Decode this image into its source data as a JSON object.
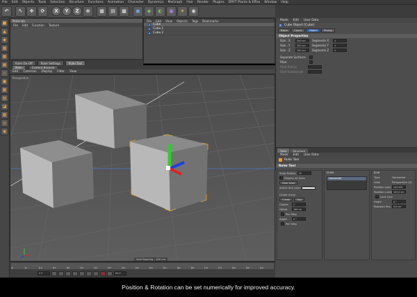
{
  "menu": [
    "File",
    "Edit",
    "Objects",
    "Tools",
    "Selection",
    "Structure",
    "Functions",
    "Animation",
    "Character",
    "Dynamics",
    "MoGraph",
    "Hair",
    "Render",
    "Plugins",
    "DRYT Plants & Effex",
    "Window",
    "Help"
  ],
  "toolbar": {
    "undo": "↶",
    "live": "↖",
    "move": "✥",
    "rotate": "⟳",
    "x_axis": "X",
    "y_axis": "Y",
    "z_axis": "Z",
    "coord": "⊕",
    "render1": "▦",
    "render2": "▤",
    "render3": "▩",
    "cube": "◼",
    "extra1": "◆",
    "extra2": "◐",
    "extra3": "▣",
    "extra4": "✶",
    "extra5": "◉"
  },
  "left_icons": [
    "■",
    "▲",
    "◆",
    "▦",
    "▦",
    "▦",
    "◇",
    "◼",
    "▦",
    "▤",
    "◪",
    "▩",
    "◎",
    "◉"
  ],
  "script_window": {
    "title": "Materials",
    "menu": [
      "File",
      "Edit",
      "Function",
      "Texture"
    ]
  },
  "object_manager": {
    "menu": [
      "File",
      "Edit",
      "View",
      "Objects",
      "Tags",
      "Bookmarks"
    ],
    "objects": [
      "Cube",
      "Cube.1",
      "Cube.2"
    ]
  },
  "viewport_tabs": [
    "Ruler On-Off",
    "Ruler Settings",
    "Ruler Tool"
  ],
  "viewport_head": [
    "Main",
    "Content Browser"
  ],
  "viewport_menu": [
    "Edit",
    "Cameras",
    "Display",
    "Filter",
    "View"
  ],
  "viewport_label": "Perspective",
  "grid_status": "Grid Spacing : 100 cm",
  "timeline": {
    "ticks": [
      "0",
      "5",
      "10",
      "15",
      "20",
      "25",
      "30",
      "35",
      "40",
      "45",
      "50",
      "55",
      "60",
      "65",
      "70",
      "75",
      "80",
      "85",
      "90"
    ],
    "start": "0 F",
    "end": "90 F"
  },
  "attributes": {
    "menu": [
      "Mode",
      "Edit",
      "User Data"
    ],
    "object": "Cube Object [Cube]",
    "tabs": [
      "Basic",
      "Coord.",
      "Object",
      "Phong"
    ],
    "section": "Object Properties",
    "rows": [
      {
        "label": "Size . X",
        "value": "200 cm",
        "seg_label": "Segments X",
        "seg": "1"
      },
      {
        "label": "Size . Y",
        "value": "200 cm",
        "seg_label": "Segments Y",
        "seg": "1"
      },
      {
        "label": "Size . Z",
        "value": "200 cm",
        "seg_label": "Segments Z",
        "seg": "1"
      }
    ],
    "separate": "Separate Surfaces",
    "fillet": "Fillet",
    "fillet_radius": "Fillet Radius",
    "fillet_sub": "Fillet Subdivision"
  },
  "tool_panel": {
    "tabs": [
      "Tools",
      "Structure"
    ],
    "menu": [
      "Mode",
      "Edit",
      "User Data"
    ],
    "tool_name": "Ruler Tool",
    "section": "Ruler Tool"
  },
  "ruler": {
    "snap_radius": "Snap Radius",
    "snap_value": "20",
    "display_all": "Display all lines",
    "clear_lines": "Clear Lines",
    "active_color": "Active line color",
    "linear_array": "Linear Array",
    "create": "Create",
    "stop": "Stop",
    "copies": "Copies",
    "copies_val": "2",
    "offset": "Offset",
    "offset_val": "100 cm",
    "per_step1": "Per Step",
    "angle": "Angle",
    "angle_val": "0 °",
    "per_step2": "Per Step",
    "lines_title": "Lines",
    "line_item": "Horizontal",
    "line_title": "Line",
    "type_label": "Type",
    "type_val": "Horizontal",
    "view_label": "View",
    "view_val": "Perspective (0)",
    "pos_label": "Position (pix)",
    "pos_val": "243.501",
    "pos_unit_label": "Position (unit)",
    "pos_unit_val": "103.0 cm",
    "lock_line": "Lock Line",
    "angle2_label": "Angle",
    "angle2_val": "0 °",
    "rot_label": "Rotation Pos.",
    "rot_val": "0.0 cm"
  },
  "subtitle": "Position & Rotation can be set numerically for improved accuracy.",
  "colors": {
    "accent_blue": "#2f5f9f",
    "selection_orange": "#e8a030",
    "axis_green": "#2ecc2e",
    "axis_red": "#e02020",
    "axis_blue": "#2040e0"
  }
}
